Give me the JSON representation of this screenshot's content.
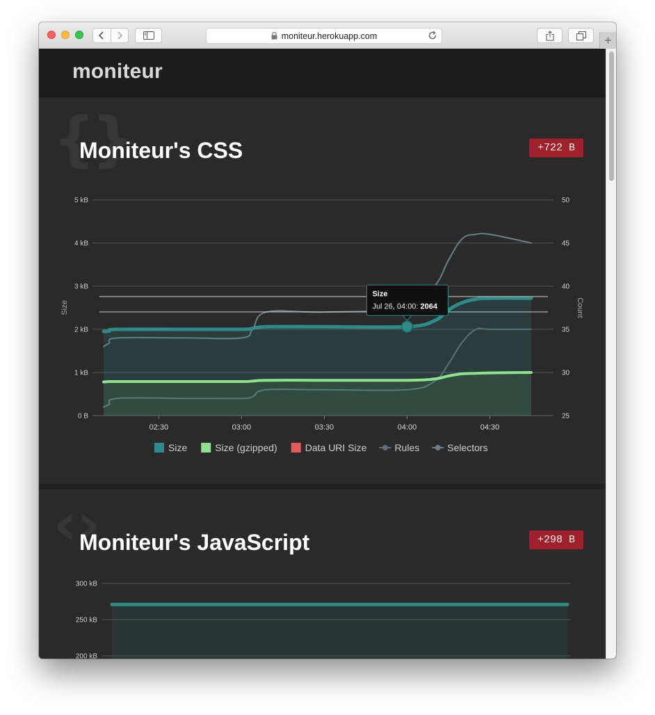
{
  "browser": {
    "url": "moniteur.herokuapp.com"
  },
  "app": {
    "title": "moniteur"
  },
  "cards": [
    {
      "title": "Moniteur's CSS",
      "badge": "+722 B",
      "icon": "curly-braces-icon",
      "icon_glyph": "{}"
    },
    {
      "title": "Moniteur's JavaScript",
      "badge": "+298 B",
      "icon": "angle-brackets-icon",
      "icon_glyph": "‹›"
    }
  ],
  "chart_data": [
    {
      "type": "area",
      "x_ticks": [
        "02:30",
        "03:00",
        "03:30",
        "04:00",
        "04:30"
      ],
      "x_values": [
        "02:10",
        "02:12",
        "02:15",
        "02:40",
        "03:00",
        "03:04",
        "03:09",
        "03:30",
        "04:00",
        "04:10",
        "04:15",
        "04:20",
        "04:25",
        "04:30",
        "04:45"
      ],
      "ylabel_left": "Size",
      "ylabel_right": "Count",
      "ylim_left": [
        0,
        5
      ],
      "ylim_right": [
        25,
        50
      ],
      "y_ticks_left": [
        "0 B",
        "1 kB",
        "2 kB",
        "3 kB",
        "4 kB",
        "5 kB"
      ],
      "y_ticks_right": [
        "25",
        "30",
        "35",
        "40",
        "45",
        "50"
      ],
      "grid": true,
      "legend_position": "bottom",
      "series": [
        {
          "name": "Size",
          "axis": "left",
          "unit": "kB",
          "color": "#2e8b89",
          "values": [
            1.95,
            1.96,
            2.0,
            2.0,
            2.0,
            2.02,
            2.06,
            2.06,
            2.06,
            2.2,
            2.45,
            2.62,
            2.7,
            2.72,
            2.72
          ]
        },
        {
          "name": "Size (gzipped)",
          "axis": "left",
          "unit": "kB",
          "color": "#8ee28e",
          "values": [
            0.78,
            0.79,
            0.79,
            0.79,
            0.79,
            0.8,
            0.82,
            0.82,
            0.82,
            0.85,
            0.92,
            0.97,
            0.98,
            0.99,
            1.0
          ]
        },
        {
          "name": "Data URI Size",
          "axis": "left",
          "unit": "kB",
          "color": "#e45a5a",
          "values": []
        },
        {
          "name": "Rules",
          "axis": "right",
          "color": "#5d6e76",
          "values": [
            26,
            26.3,
            27,
            27,
            27,
            27.2,
            28,
            28,
            28,
            29,
            31,
            33.5,
            35,
            35,
            35
          ]
        },
        {
          "name": "Selectors",
          "axis": "right",
          "color": "#6c7f86",
          "values": [
            33,
            33.4,
            34,
            34,
            34,
            35,
            37,
            37,
            37.5,
            40,
            43,
            45.5,
            46,
            46,
            45
          ]
        }
      ],
      "tooltip": {
        "title": "Size",
        "label": "Jul 26, 04:00: ",
        "value": "2064",
        "series_index": 0,
        "point_index": 8
      }
    },
    {
      "type": "area",
      "ylabel_left": "",
      "y_ticks_left": [
        "200 kB",
        "250 kB",
        "300 kB"
      ],
      "ylim_left": [
        200,
        300
      ],
      "grid": true,
      "series": [
        {
          "name": "Size",
          "axis": "left",
          "unit": "kB",
          "color": "#2e8b89",
          "values": [
            271,
            271,
            271,
            271,
            271,
            271,
            271
          ]
        }
      ]
    }
  ]
}
